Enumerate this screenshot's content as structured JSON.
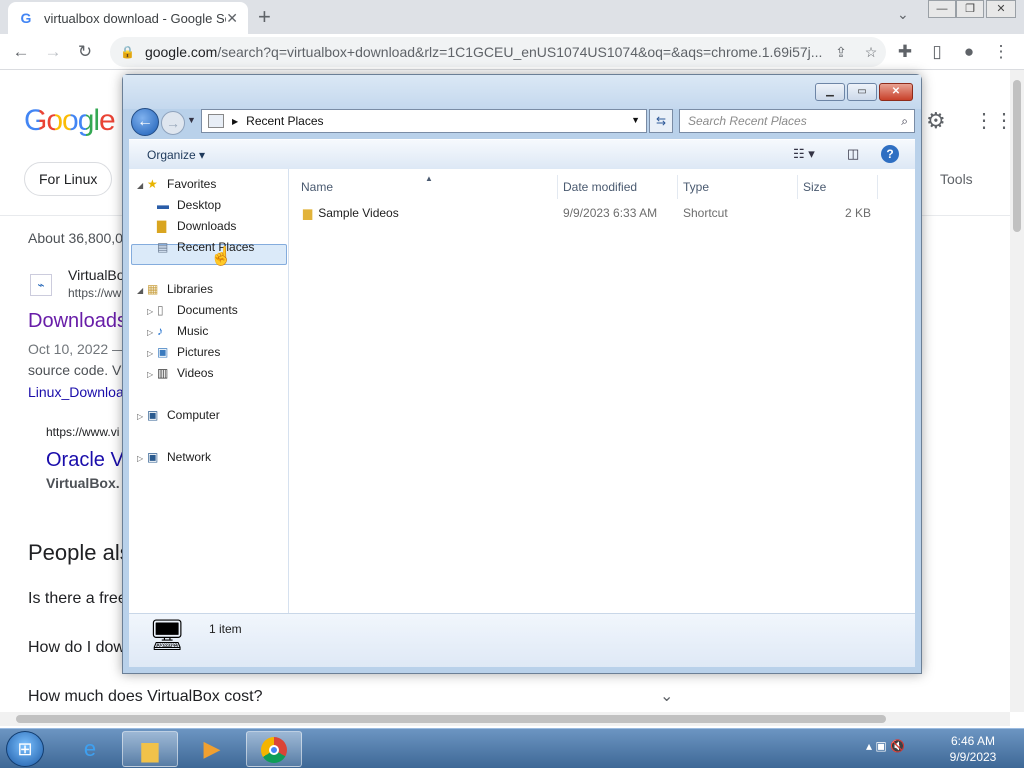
{
  "browser": {
    "tab_title": "virtualbox download - Google Se",
    "tab_favicon": "G",
    "url_domain": "google.com",
    "url_rest": "/search?q=virtualbox+download&rlz=1C1GCEU_enUS1074US1074&oq=&aqs=chrome.1.69i57j..."
  },
  "google": {
    "logo": "Google",
    "chip": "For Linux",
    "tools": "Tools",
    "about": "About 36,800,0",
    "result1_site": "VirtualBo",
    "result1_url": "https://ww",
    "result1_title": "Downloads",
    "result1_date": "Oct 10, 2022 —",
    "result1_snip": "source code. V",
    "result1_link": "Linux_Downloa",
    "result2_url": "https://www.vi",
    "result2_title": "Oracle V",
    "result2_snip": "VirtualBox.",
    "paa": "People als",
    "q1": "Is there a free",
    "q2": "How do I dow",
    "q3": "How much does VirtualBox cost?"
  },
  "explorer": {
    "address": "Recent Places",
    "search_placeholder": "Search Recent Places",
    "organize": "Organize",
    "tree": {
      "favorites": "Favorites",
      "desktop": "Desktop",
      "downloads": "Downloads",
      "recent": "Recent Places",
      "libraries": "Libraries",
      "documents": "Documents",
      "music": "Music",
      "pictures": "Pictures",
      "videos": "Videos",
      "computer": "Computer",
      "network": "Network"
    },
    "columns": {
      "name": "Name",
      "date": "Date modified",
      "type": "Type",
      "size": "Size"
    },
    "rows": [
      {
        "name": "Sample Videos",
        "date": "9/9/2023 6:33 AM",
        "type": "Shortcut",
        "size": "2 KB"
      }
    ],
    "status": "1 item"
  },
  "taskbar": {
    "time": "6:46 AM",
    "date": "9/9/2023"
  }
}
